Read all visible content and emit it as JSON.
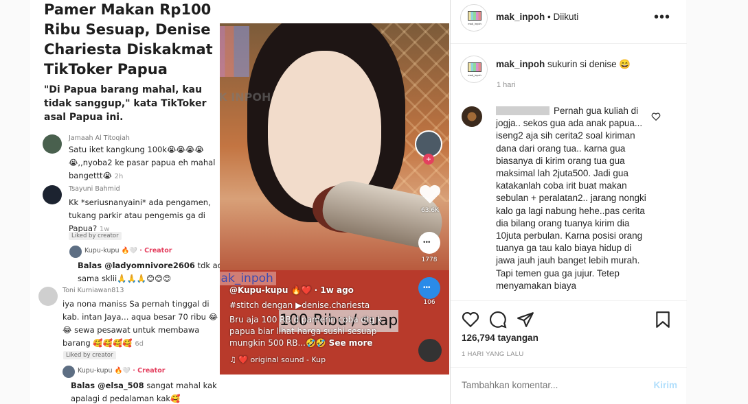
{
  "media": {
    "headline": "Pamer Makan Rp100 Ribu Sesuap, Denise Chariesta Diskakmat TikToker Papua",
    "quote": "\"Di Papua barang mahal, kau tidak sanggup,\" kata TikToker asal Papua ini.",
    "comments": [
      {
        "user": "Jamaah Al Titoqiah",
        "text": "Satu iket kangkung 100k😭😭😭😭😭,,nyoba2 ke pasar papua eh mahal bangettt😭",
        "meta": "2h"
      },
      {
        "user": "Tsayuni Bahmid",
        "text": "Kk *seriusnanyaini* ada pengamen, tukang parkir atau pengemis ga di Papua?",
        "meta": "1w",
        "liked": "Liked by creator"
      },
      {
        "user": "Toni Kurniawan813",
        "text": "iya nona maniss Sa pernah tinggal di kab. intan Jaya... aqua besar 70 ribu 😂😂 sewa pesawat untuk membawa barang 🥰🥰🥰🥰",
        "meta": "6d",
        "liked": "Liked by creator"
      }
    ],
    "replies": [
      {
        "user": "Kupu-kupu 🔥🤍",
        "creator": "· Creator",
        "mention": "Balas @ladyomnivore2606",
        "text": " tdk ad sama sklii🙏🙏🙏😊😊😊"
      },
      {
        "user": "Kupu-kupu 🔥🤍",
        "creator": "· Creator",
        "mention": "Balas @elsa_508",
        "text": " sangat mahal kak apalagi d pedalaman kak🥰"
      }
    ],
    "video": {
      "watermark_handle": "@mak_inpoh",
      "logo_text": "MAK INPOH",
      "overlay_caption": "100 Ribu / suap",
      "author": "@Kupu-kupu 🔥❤️ · 1w ago",
      "hashtag": "#stitch dengan ▶denise.chariesta",
      "desc": "Bru aja 100 RB d pamerin coba dtg k papua biar lihat harga sushi sesuap mungkin 500 RB...🤣🤣",
      "see_more": "See more",
      "sound": "♫ ❤️ original sound - Kup",
      "likes": "63.6K",
      "comments": "1778",
      "shares": "106"
    }
  },
  "panel": {
    "account": "mak_inpoh",
    "follow_status": "• Diikuti",
    "caption_user": "mak_inpoh",
    "caption_text": "sukurin si denise 😄",
    "caption_time": "1 hari",
    "comment_text": "Pernah gua kuliah di jogja.. sekos gua ada anak papua... iseng2 aja sih cerita2 soal kiriman dana dari orang tua.. karna gua biasanya di kirim orang tua gua maksimal lah 2juta500. Jadi gua katakanlah coba irit buat makan sebulan + peralatan2.. jarang nongki kalo ga lagi nabung hehe..pas cerita dia bilang orang tuanya kirim dia 10juta perbulan. Karna posisi orang tuanya ga tau kalo biaya hidup di jawa jauh jauh banget lebih murah. Tapi temen gua ga jujur. Tetep menyamakan biaya",
    "views": "126,794 tayangan",
    "post_time": "1 HARI YANG LALU",
    "add_comment_placeholder": "Tambahkan komentar...",
    "post_button": "Kirim",
    "logo_label": "mak_inpoh"
  },
  "colors": {
    "creator": "#e4405f",
    "post_disabled": "#b2dffc",
    "muted": "#8e8e8e"
  }
}
